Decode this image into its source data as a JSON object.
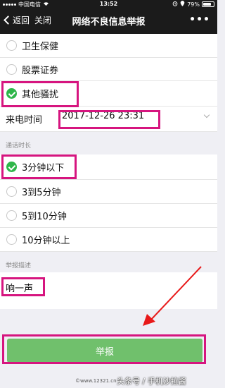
{
  "status_bar": {
    "carrier": "中国电信",
    "time": "13:52",
    "battery": "79%",
    "battery_level": 0.79
  },
  "nav": {
    "back_label": "返回",
    "close_label": "关闭",
    "title": "网络不良信息举报",
    "more": "•••"
  },
  "category_options": [
    {
      "label": "卫生保健",
      "checked": false
    },
    {
      "label": "股票证券",
      "checked": false
    },
    {
      "label": "其他骚扰",
      "checked": true
    }
  ],
  "call_time": {
    "label": "来电时间",
    "value": "2017-12-26 23:31"
  },
  "duration": {
    "label": "通话时长",
    "options": [
      {
        "label": "3分钟以下",
        "checked": true
      },
      {
        "label": "3到5分钟",
        "checked": false
      },
      {
        "label": "5到10分钟",
        "checked": false
      },
      {
        "label": "10分钟以上",
        "checked": false
      }
    ]
  },
  "description": {
    "label": "举报描述",
    "value": "响一声"
  },
  "submit": {
    "label": "举报"
  },
  "watermark": {
    "url": "©www.12321.cn",
    "source": "头条号 / 手机沙拉酱"
  },
  "colors": {
    "nav_bg": "#1b1b1b",
    "check_green": "#2fb64a",
    "button_green": "#70c06c",
    "annotation_magenta": "#d6157f",
    "page_bg": "#efeff4"
  }
}
